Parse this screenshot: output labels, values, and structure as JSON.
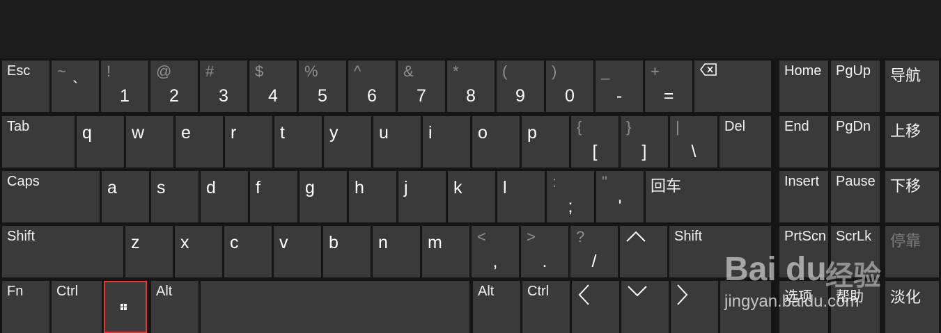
{
  "keys": {
    "esc": "Esc",
    "tilde": {
      "shift": "~",
      "main": "`"
    },
    "n1": {
      "shift": "!",
      "main": "1"
    },
    "n2": {
      "shift": "@",
      "main": "2"
    },
    "n3": {
      "shift": "#",
      "main": "3"
    },
    "n4": {
      "shift": "$",
      "main": "4"
    },
    "n5": {
      "shift": "%",
      "main": "5"
    },
    "n6": {
      "shift": "^",
      "main": "6"
    },
    "n7": {
      "shift": "&",
      "main": "7"
    },
    "n8": {
      "shift": "*",
      "main": "8"
    },
    "n9": {
      "shift": "(",
      "main": "9"
    },
    "n0": {
      "shift": ")",
      "main": "0"
    },
    "minus": {
      "shift": "_",
      "main": "-"
    },
    "equals": {
      "shift": "+",
      "main": "="
    },
    "home": "Home",
    "pgup": "PgUp",
    "nav": "导航",
    "tab": "Tab",
    "q": "q",
    "w": "w",
    "e": "e",
    "r": "r",
    "t": "t",
    "y": "y",
    "u": "u",
    "i": "i",
    "o": "o",
    "p": "p",
    "lbracket": {
      "shift": "{",
      "main": "["
    },
    "rbracket": {
      "shift": "}",
      "main": "]"
    },
    "backslash": {
      "shift": "|",
      "main": "\\"
    },
    "del": "Del",
    "end": "End",
    "pgdn": "PgDn",
    "moveup": "上移",
    "caps": "Caps",
    "a": "a",
    "s": "s",
    "d": "d",
    "f": "f",
    "g": "g",
    "h": "h",
    "j": "j",
    "k": "k",
    "l": "l",
    "semicolon": {
      "shift": ":",
      "main": ";"
    },
    "quote": {
      "shift": "\"",
      "main": "'"
    },
    "enter": "回车",
    "insert": "Insert",
    "pause": "Pause",
    "movedown": "下移",
    "lshift": "Shift",
    "z": "z",
    "x": "x",
    "c": "c",
    "v": "v",
    "b": "b",
    "n": "n",
    "m": "m",
    "comma": {
      "shift": "<",
      "main": ","
    },
    "period": {
      "shift": ">",
      "main": "."
    },
    "slash": {
      "shift": "?",
      "main": "/"
    },
    "rshift": "Shift",
    "prtscn": "PrtScn",
    "scrlk": "ScrLk",
    "dock": "停靠",
    "fn": "Fn",
    "lctrl": "Ctrl",
    "lalt": "Alt",
    "ralt": "Alt",
    "rctrl": "Ctrl",
    "options": "选项",
    "help": "帮助",
    "fade": "淡化"
  },
  "icons": {
    "backspace": "backspace-icon",
    "windows": "windows-logo-icon",
    "up": "arrow-up-icon",
    "down": "arrow-down-icon",
    "left": "arrow-left-icon",
    "right": "arrow-right-icon"
  },
  "colors": {
    "key_bg": "#3a3a3a",
    "highlight": "#e53935",
    "background": "#151515"
  },
  "watermark": {
    "brand": "Bai du",
    "sub": "经验",
    "url": "jingyan.baidu.com"
  }
}
